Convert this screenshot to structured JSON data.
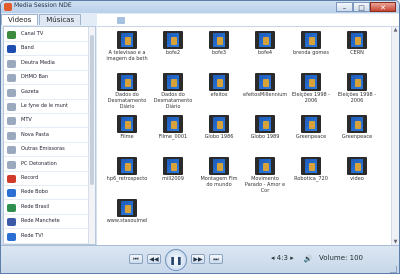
{
  "window": {
    "title": "Media Session NDE",
    "min_label": "–",
    "max_label": "□",
    "close_label": "✕"
  },
  "tabs": [
    {
      "label": "Videos"
    },
    {
      "label": "Músicas"
    }
  ],
  "sidebar": {
    "items": [
      {
        "label": "Canal TV",
        "icon": "tv-icon",
        "color": "#3b8a3e"
      },
      {
        "label": "Band",
        "icon": "band-logo-icon",
        "color": "#1e4fb0"
      },
      {
        "label": "Deutra Media",
        "icon": "channel-icon",
        "color": "#9aa9bd"
      },
      {
        "label": "DHMO Ban",
        "icon": "channel-icon",
        "color": "#9aa9bd"
      },
      {
        "label": "Gazeta",
        "icon": "channel-icon",
        "color": "#9aa9bd"
      },
      {
        "label": "Le fyne de le munt",
        "icon": "channel-icon",
        "color": "#9aa9bd"
      },
      {
        "label": "MTV",
        "icon": "channel-icon",
        "color": "#9aa9bd"
      },
      {
        "label": "Nova Pasta",
        "icon": "folder-icon",
        "color": "#9aa9bd"
      },
      {
        "label": "Outras Emissoras",
        "icon": "channel-icon",
        "color": "#9aa9bd"
      },
      {
        "label": "PC Detonation",
        "icon": "channel-icon",
        "color": "#9aa9bd"
      },
      {
        "label": "Record",
        "icon": "record-logo-icon",
        "color": "#d23b2b"
      },
      {
        "label": "Rede Bobo",
        "icon": "globo-logo-icon",
        "color": "#2b6fd3"
      },
      {
        "label": "Rede Brasil",
        "icon": "channel-icon",
        "color": "#2f8f4f"
      },
      {
        "label": "Rede Manchete",
        "icon": "channel-icon",
        "color": "#3d5aa9"
      },
      {
        "label": "Rede TV!",
        "icon": "channel-icon",
        "color": "#2b6fd3"
      }
    ]
  },
  "videos": [
    "A televisao e a imagem da beth",
    "bofe2",
    "bofe3",
    "bofe4",
    "brenda gomes",
    "CERN",
    "Dados do Desmatamento Diário",
    "Dados do Desmatamento Diário",
    "efeitos",
    "efeitosMillennium",
    "Eleições 1998 - 2006",
    "Eleições 1998 - 2006",
    "Filme",
    "Filme_0001",
    "Globo 1986",
    "Globo 1989",
    "Greenpeace",
    "Greenpeace",
    "hp6_retrospecto",
    "mill2009",
    "Montagem Fim do mundo",
    "Movimento Parado - Amor e Cor",
    "Robotica_720",
    "video",
    "www.stasoulmel"
  ],
  "controls": {
    "prev": "⏮",
    "rewind": "◀◀",
    "play": "❚❚",
    "forward": "▶▶",
    "next": "⏭",
    "ratio": "4:3",
    "volume_label": "Volume: 100",
    "volume_icon": "🔊"
  }
}
